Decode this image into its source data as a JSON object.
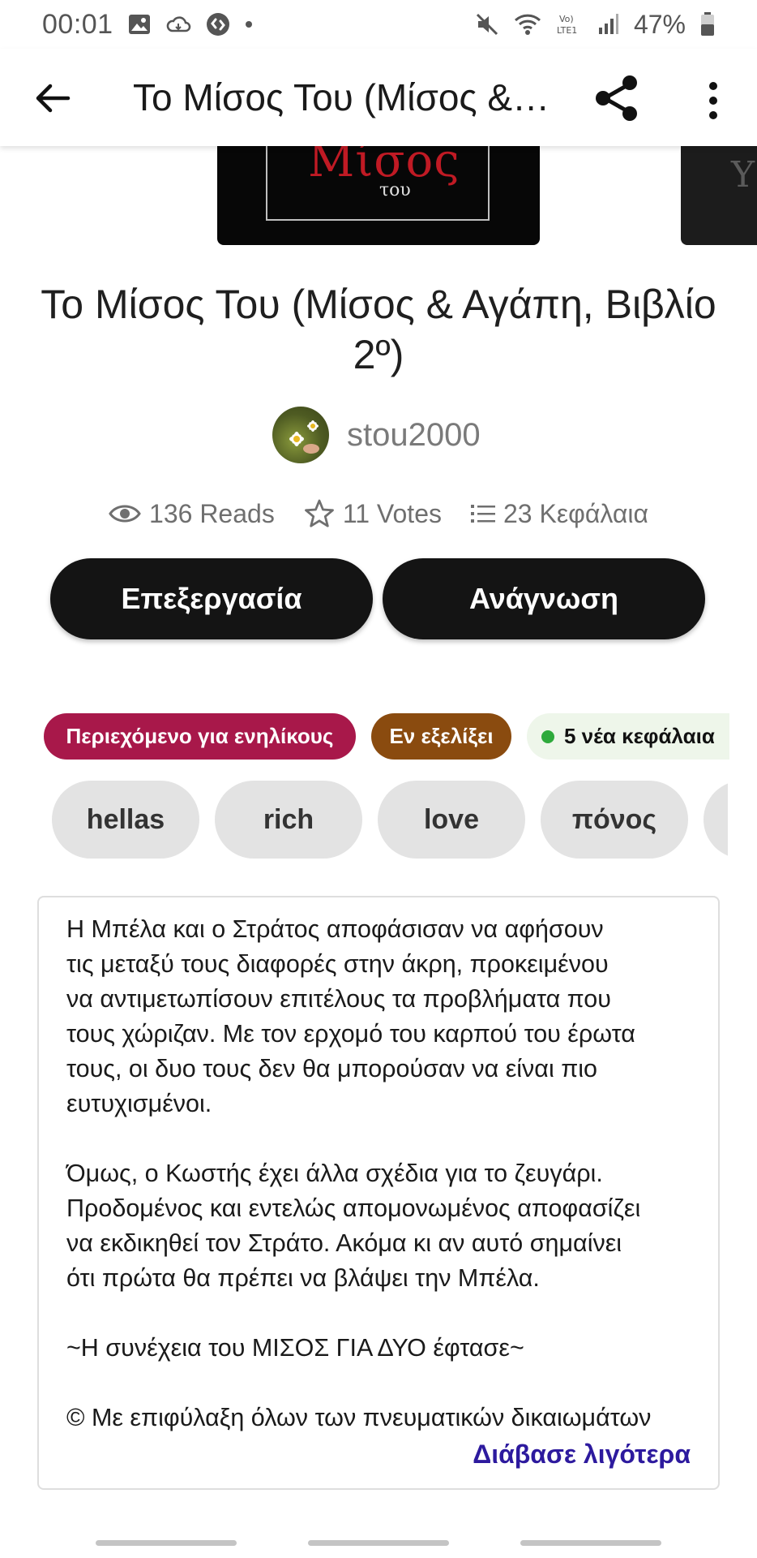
{
  "status_bar": {
    "time": "00:01",
    "battery_percent": "47%",
    "icons_left": [
      "image-icon",
      "cloud-icon",
      "shazam-icon",
      "dot-icon"
    ],
    "icons_right": [
      "mute-icon",
      "wifi-icon",
      "volte-icon",
      "signal-icon",
      "battery-icon"
    ]
  },
  "app_bar": {
    "title": "Το Μίσος Του (Μίσος &…"
  },
  "story": {
    "title": "Το Μίσος Του (Μίσος & Αγάπη, Βιβλίο 2º)",
    "cover_title": "Μίσος",
    "cover_subtitle": "του",
    "next_cover_text": "Υ"
  },
  "author": {
    "username": "stou2000"
  },
  "stats": {
    "reads": "136 Reads",
    "votes": "11 Votes",
    "chapters": "23 Κεφάλαια"
  },
  "buttons": {
    "edit": "Επεξεργασία",
    "read": "Ανάγνωση"
  },
  "badges": {
    "mature": "Περιεχόμενο για ενηλίκους",
    "ongoing": "Εν εξελίξει",
    "new_chapters": "5 νέα κεφάλαια"
  },
  "tags": [
    "hellas",
    "rich",
    "love",
    "πόνος"
  ],
  "description": {
    "text": "Η Μπέλα και ο Στράτος αποφάσισαν να αφήσουν\nτις μεταξύ τους διαφορές στην άκρη, προκειμένου\nνα αντιμετωπίσουν επιτέλους τα προβλήματα που\nτους χώριζαν. Με τον ερχομό του καρπού του έρωτα\nτους, οι δυο τους δεν θα μπορούσαν να είναι πιο\nευτυχισμένοι.\n\nΌμως, ο Κωστής έχει άλλα σχέδια για το ζευγάρι.\nΠροδομένος και εντελώς απομονωμένος αποφασίζει\nνα εκδικηθεί τον Στράτο. Ακόμα κι αν αυτό σημαίνει\nότι πρώτα θα πρέπει να βλάψει την Μπέλα.\n\n~Η συνέχεια του ΜΙΣΟΣ ΓΙΑ ΔΥΟ έφτασε~\n\n© Με επιφύλαξη όλων των πνευματικών δικαιωμάτων",
    "read_more": "Διάβασε λιγότερα"
  },
  "colors": {
    "mature_badge": "#a8184a",
    "ongoing_badge": "#8a4b0f",
    "new_badge_bg": "#eef6ea",
    "new_dot": "#2eaa3c",
    "read_more_link": "#2d1a9e",
    "primary_button": "#141414"
  }
}
